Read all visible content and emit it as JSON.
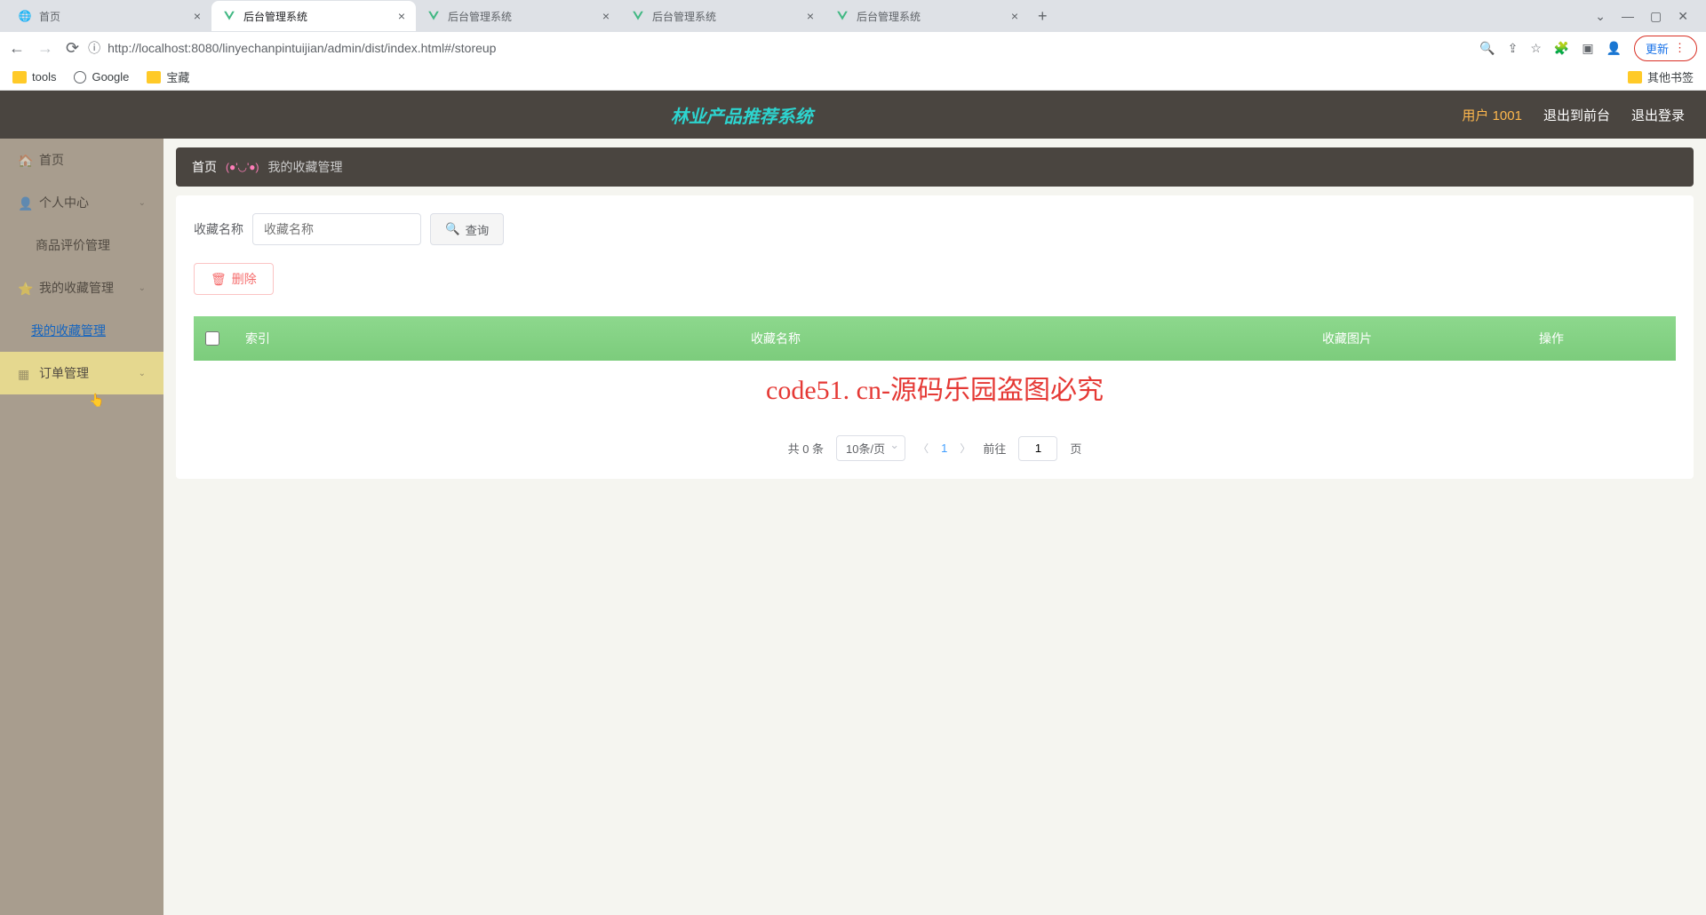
{
  "browser": {
    "tabs": [
      {
        "title": "首页",
        "icon": "globe"
      },
      {
        "title": "后台管理系统",
        "icon": "vue",
        "active": true
      },
      {
        "title": "后台管理系统",
        "icon": "vue"
      },
      {
        "title": "后台管理系统",
        "icon": "vue"
      },
      {
        "title": "后台管理系统",
        "icon": "vue"
      }
    ],
    "url": "http://localhost:8080/linyechanpintuijian/admin/dist/index.html#/storeup",
    "update_label": "更新",
    "bookmarks": [
      {
        "label": "tools",
        "type": "folder"
      },
      {
        "label": "Google",
        "type": "globe"
      },
      {
        "label": "宝藏",
        "type": "folder"
      }
    ],
    "other_bookmarks": "其他书签"
  },
  "header": {
    "title": "林业产品推荐系统",
    "user": "用户 1001",
    "to_front": "退出到前台",
    "logout": "退出登录"
  },
  "sidebar": {
    "items": [
      {
        "label": "首页",
        "icon": "home"
      },
      {
        "label": "个人中心",
        "icon": "user",
        "chevron": true
      },
      {
        "label": "商品评价管理",
        "sub": true
      },
      {
        "label": "我的收藏管理",
        "icon": "star",
        "chevron": true
      },
      {
        "label": "我的收藏管理",
        "activeSub": true
      },
      {
        "label": "订单管理",
        "icon": "grid",
        "chevron": true,
        "highlighted": true
      }
    ]
  },
  "breadcrumb": {
    "home": "首页",
    "emoji": "(●'◡'●)",
    "current": "我的收藏管理"
  },
  "search": {
    "label": "收藏名称",
    "placeholder": "收藏名称",
    "button": "查询"
  },
  "actions": {
    "delete": "删除"
  },
  "table": {
    "headers": {
      "index": "索引",
      "name": "收藏名称",
      "image": "收藏图片",
      "action": "操作"
    },
    "watermark": "code51. cn-源码乐园盗图必究"
  },
  "pagination": {
    "total": "共 0 条",
    "per_page": "10条/页",
    "current": "1",
    "goto_prefix": "前往",
    "goto_value": "1",
    "goto_suffix": "页"
  },
  "bg_watermark": "code51.cn"
}
